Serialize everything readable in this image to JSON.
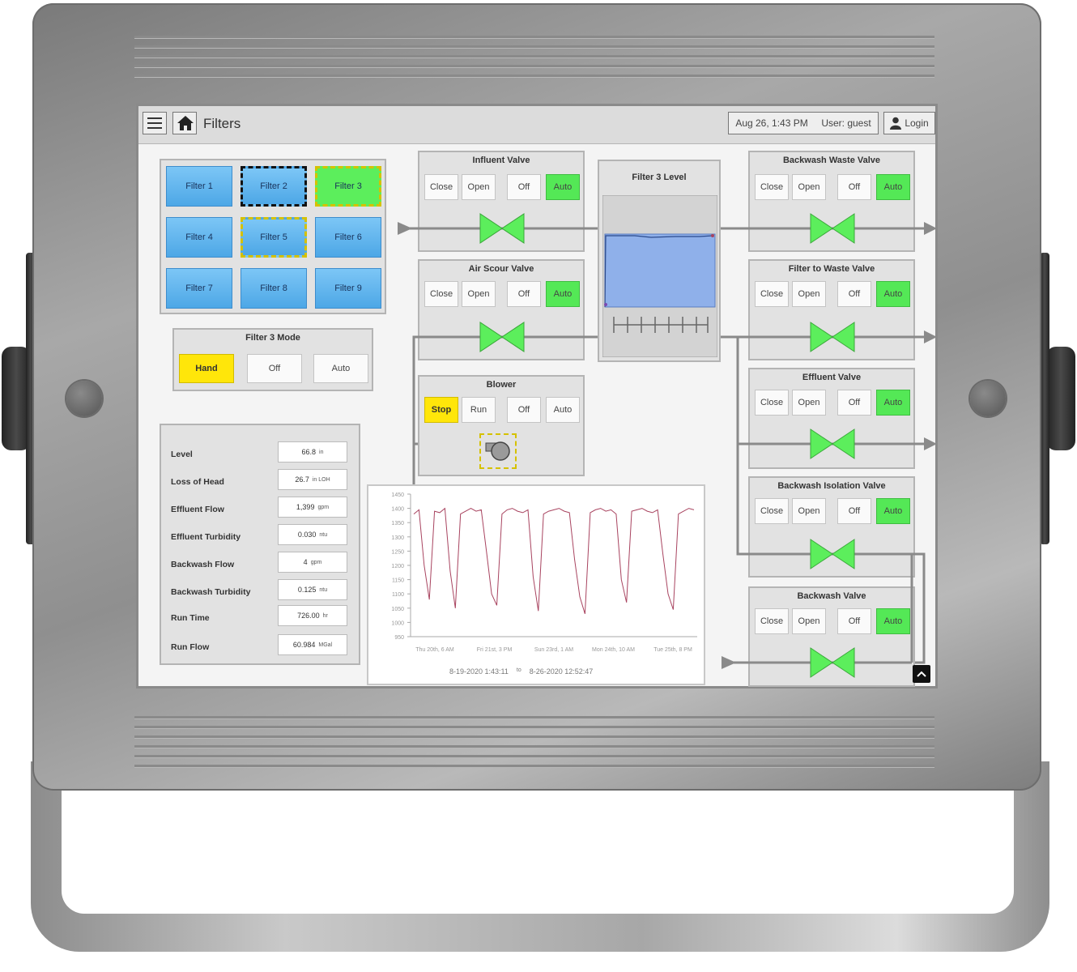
{
  "topbar": {
    "title": "Filters",
    "datetime": "Aug 26, 1:43 PM",
    "user": "User: guest",
    "login": "Login"
  },
  "filters": [
    "Filter 1",
    "Filter 2",
    "Filter 3",
    "Filter 4",
    "Filter 5",
    "Filter 6",
    "Filter 7",
    "Filter 8",
    "Filter 9"
  ],
  "mode": {
    "title": "Filter 3 Mode",
    "hand": "Hand",
    "off": "Off",
    "auto": "Auto"
  },
  "readings": [
    {
      "label": "Level",
      "value": "66.8",
      "unit": "in"
    },
    {
      "label": "Loss of Head",
      "value": "26.7",
      "unit": "in LOH"
    },
    {
      "label": "Effluent Flow",
      "value": "1,399",
      "unit": "gpm"
    },
    {
      "label": "Effluent Turbidity",
      "value": "0.030",
      "unit": "ntu"
    },
    {
      "label": "Backwash Flow",
      "value": "4",
      "unit": "gpm"
    },
    {
      "label": "Backwash Turbidity",
      "value": "0.125",
      "unit": "ntu"
    },
    {
      "label": "Run Time",
      "value": "726.00",
      "unit": "hr"
    },
    {
      "label": "Run Flow",
      "value": "60.984",
      "unit": "MGal"
    }
  ],
  "valves": {
    "influent": "Influent Valve",
    "air_scour": "Air Scour Valve",
    "backwash_waste": "Backwash Waste Valve",
    "filter_to_waste": "Filter to Waste Valve",
    "effluent": "Effluent Valve",
    "backwash_isolation": "Backwash Isolation Valve",
    "backwash": "Backwash Valve"
  },
  "valve_buttons": {
    "close": "Close",
    "open": "Open",
    "off": "Off",
    "auto": "Auto"
  },
  "blower": {
    "title": "Blower",
    "stop": "Stop",
    "run": "Run",
    "off": "Off",
    "auto": "Auto"
  },
  "level": {
    "title": "Filter 3 Level"
  },
  "colors": {
    "auto": "#54e856",
    "hand": "#ffe60a",
    "filter": "#5bb2ec",
    "trend": "#a8435f",
    "water": "#8fb0ea"
  },
  "chart_data": {
    "type": "line",
    "title": "",
    "xlabel": "",
    "ylabel": "",
    "ylim": [
      950,
      1450
    ],
    "y_ticks": [
      1450,
      1400,
      1350,
      1300,
      1250,
      1200,
      1150,
      1100,
      1050,
      1000,
      950
    ],
    "x_tick_labels": [
      "Thu 20th, 6 AM",
      "Fri 21st, 3 PM",
      "Sun 23rd, 1 AM",
      "Mon 24th, 10 AM",
      "Tue 25th, 8 PM"
    ],
    "range_start": "8-19-2020 1:43:11",
    "range_sep": "to",
    "range_end": "8-26-2020 12:52:47",
    "series": [
      {
        "values": [
          1380,
          1395,
          1200,
          1080,
          1390,
          1385,
          1400,
          1180,
          1050,
          1380,
          1390,
          1400,
          1390,
          1395,
          1250,
          1100,
          1060,
          1380,
          1395,
          1400,
          1390,
          1385,
          1395,
          1160,
          1040,
          1380,
          1390,
          1395,
          1400,
          1390,
          1385,
          1220,
          1090,
          1030,
          1385,
          1395,
          1400,
          1390,
          1395,
          1380,
          1150,
          1070,
          1390,
          1395,
          1400,
          1390,
          1385,
          1395,
          1240,
          1100,
          1045,
          1380,
          1390,
          1400,
          1395
        ]
      }
    ]
  }
}
